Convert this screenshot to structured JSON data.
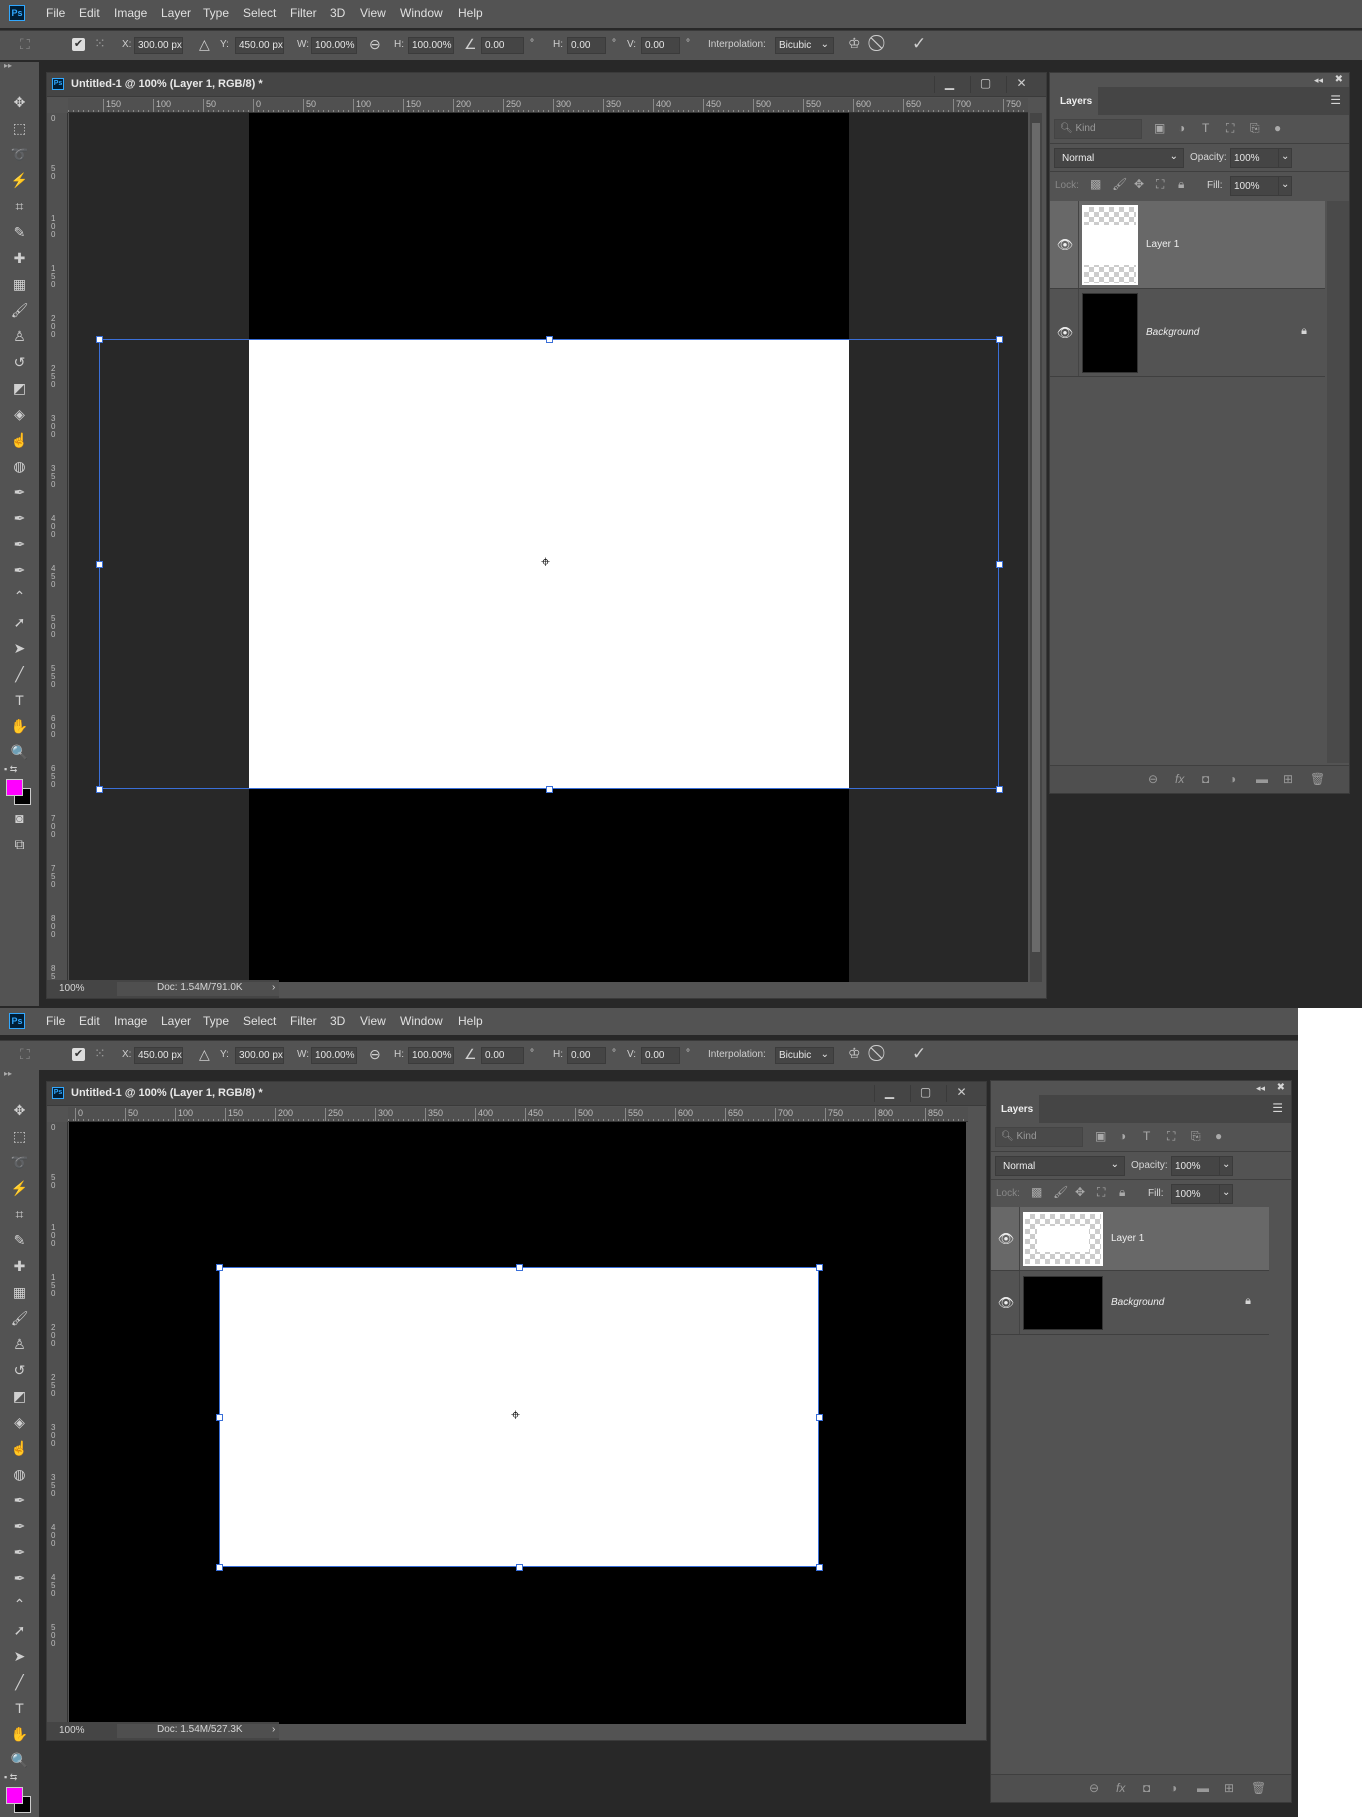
{
  "colors": {
    "accent": "#31a8ff",
    "foreground_color": "#ff00ff",
    "background_color": "#000000",
    "selection": "#3a6fd8"
  },
  "screens": [
    {
      "app_logo": "Ps",
      "menu": [
        "File",
        "Edit",
        "Image",
        "Layer",
        "Type",
        "Select",
        "Filter",
        "3D",
        "View",
        "Window",
        "Help"
      ],
      "options": {
        "x_label": "X:",
        "x": "300.00 px",
        "y_label": "Y:",
        "y": "450.00 px",
        "w_label": "W:",
        "w": "100.00%",
        "h_label": "H:",
        "h": "100.00%",
        "angle": "0.00",
        "hskew_label": "H:",
        "hskew": "0.00",
        "vskew_label": "V:",
        "vskew": "0.00",
        "degree": "°",
        "interpolation_label": "Interpolation:",
        "interpolation": "Bicubic"
      },
      "document": {
        "title": "Untitled-1 @ 100% (Layer 1, RGB/8) *",
        "zoom": "100%",
        "doc_info": "Doc: 1.54M/791.0K",
        "ruler_h": [
          "150",
          "100",
          "50",
          "0",
          "50",
          "100",
          "150",
          "200",
          "250",
          "300",
          "350",
          "400",
          "450",
          "500",
          "550",
          "600",
          "650",
          "700",
          "750"
        ],
        "ruler_v": [
          "0",
          "50",
          "100",
          "150",
          "200",
          "250",
          "300",
          "350",
          "400",
          "450",
          "500",
          "550",
          "600",
          "650",
          "700",
          "750",
          "800",
          "85"
        ]
      },
      "layers_panel": {
        "tab": "Layers",
        "filter_placeholder": "Kind",
        "blend_mode": "Normal",
        "opacity_label": "Opacity:",
        "opacity": "100%",
        "lock_label": "Lock:",
        "fill_label": "Fill:",
        "fill": "100%",
        "layers": [
          {
            "name": "Layer 1",
            "visible": true,
            "selected": true
          },
          {
            "name": "Background",
            "visible": true,
            "locked": true
          }
        ]
      }
    },
    {
      "app_logo": "Ps",
      "menu": [
        "File",
        "Edit",
        "Image",
        "Layer",
        "Type",
        "Select",
        "Filter",
        "3D",
        "View",
        "Window",
        "Help"
      ],
      "options": {
        "x_label": "X:",
        "x": "450.00 px",
        "y_label": "Y:",
        "y": "300.00 px",
        "w_label": "W:",
        "w": "100.00%",
        "h_label": "H:",
        "h": "100.00%",
        "angle": "0.00",
        "hskew_label": "H:",
        "hskew": "0.00",
        "vskew_label": "V:",
        "vskew": "0.00",
        "degree": "°",
        "interpolation_label": "Interpolation:",
        "interpolation": "Bicubic"
      },
      "document": {
        "title": "Untitled-1 @ 100% (Layer 1, RGB/8) *",
        "zoom": "100%",
        "doc_info": "Doc: 1.54M/527.3K",
        "ruler_h": [
          "0",
          "50",
          "100",
          "150",
          "200",
          "250",
          "300",
          "350",
          "400",
          "450",
          "500",
          "550",
          "600",
          "650",
          "700",
          "750",
          "800",
          "850"
        ],
        "ruler_v": [
          "0",
          "50",
          "100",
          "150",
          "200",
          "250",
          "300",
          "350",
          "400",
          "450",
          "500"
        ]
      },
      "layers_panel": {
        "tab": "Layers",
        "filter_placeholder": "Kind",
        "blend_mode": "Normal",
        "opacity_label": "Opacity:",
        "opacity": "100%",
        "lock_label": "Lock:",
        "fill_label": "Fill:",
        "fill": "100%",
        "layers": [
          {
            "name": "Layer 1",
            "visible": true,
            "selected": true
          },
          {
            "name": "Background",
            "visible": true,
            "locked": true
          }
        ]
      }
    }
  ],
  "tools": [
    {
      "name": "move-tool-icon",
      "glyph": "✥"
    },
    {
      "name": "marquee-tool-icon",
      "glyph": "⬚"
    },
    {
      "name": "lasso-tool-icon",
      "glyph": "➰"
    },
    {
      "name": "magic-wand-tool-icon",
      "glyph": "⚡"
    },
    {
      "name": "crop-tool-icon",
      "glyph": "⌗"
    },
    {
      "name": "eyedropper-tool-icon",
      "glyph": "✎"
    },
    {
      "name": "spot-healing-tool-icon",
      "glyph": "✚"
    },
    {
      "name": "healing-tool-icon",
      "glyph": "▦"
    },
    {
      "name": "brush-tool-icon",
      "glyph": "🖌"
    },
    {
      "name": "clone-stamp-tool-icon",
      "glyph": "♙"
    },
    {
      "name": "history-brush-tool-icon",
      "glyph": "↺"
    },
    {
      "name": "eraser-tool-icon",
      "glyph": "◩"
    },
    {
      "name": "paint-bucket-tool-icon",
      "glyph": "◈"
    },
    {
      "name": "smudge-tool-icon",
      "glyph": "☝"
    },
    {
      "name": "sponge-tool-icon",
      "glyph": "◍"
    },
    {
      "name": "pen-tool-icon",
      "glyph": "✒"
    },
    {
      "name": "freeform-pen-tool-icon",
      "glyph": "✒"
    },
    {
      "name": "add-anchor-tool-icon",
      "glyph": "✒"
    },
    {
      "name": "delete-anchor-tool-icon",
      "glyph": "✒"
    },
    {
      "name": "convert-point-tool-icon",
      "glyph": "⌃"
    },
    {
      "name": "path-selection-tool-icon",
      "glyph": "➚"
    },
    {
      "name": "direct-selection-tool-icon",
      "glyph": "➤"
    },
    {
      "name": "line-tool-icon",
      "glyph": "╱"
    },
    {
      "name": "type-tool-icon",
      "glyph": "T"
    },
    {
      "name": "hand-tool-icon",
      "glyph": "✋"
    },
    {
      "name": "zoom-tool-icon",
      "glyph": "🔍"
    }
  ]
}
